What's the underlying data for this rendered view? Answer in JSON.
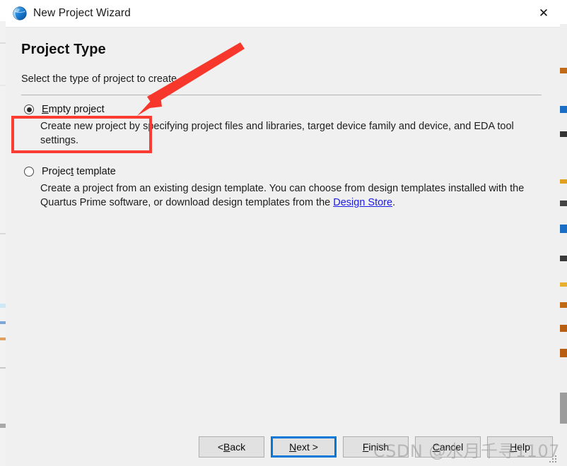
{
  "window": {
    "title": "New Project Wizard",
    "icon": "quartus-globe-icon",
    "close_label": "✕"
  },
  "page": {
    "title": "Project Type",
    "subtitle": "Select the type of project to create."
  },
  "options": [
    {
      "id": "empty-project",
      "label_pre": "",
      "label_mnemonic": "E",
      "label_post": "mpty project",
      "label_full": "Empty project",
      "selected": true,
      "description": "Create new project by specifying project files and libraries, target device family and device, and EDA tool settings."
    },
    {
      "id": "project-template",
      "label_pre": "Projec",
      "label_mnemonic": "t",
      "label_post": " template",
      "label_full": "Project template",
      "selected": false,
      "description_pre": "Create a project from an existing design template. You can choose from design templates installed with the Quartus Prime software, or download design templates from the ",
      "link_text": "Design Store",
      "description_post": "."
    }
  ],
  "footer": {
    "buttons": [
      {
        "id": "back",
        "pre": "< ",
        "mnemonic": "B",
        "post": "ack",
        "full": "< Back",
        "default": false
      },
      {
        "id": "next",
        "pre": "",
        "mnemonic": "N",
        "post": "ext >",
        "full": "Next >",
        "default": true
      },
      {
        "id": "finish",
        "pre": "",
        "mnemonic": "F",
        "post": "inish",
        "full": "Finish",
        "default": false
      },
      {
        "id": "cancel",
        "pre": "",
        "mnemonic": "C",
        "post": "ancel",
        "full": "Cancel",
        "default": false
      },
      {
        "id": "help",
        "pre": "",
        "mnemonic": "H",
        "post": "elp",
        "full": "Help",
        "default": false
      }
    ]
  },
  "watermark": {
    "text": "CSDN @水月千寻1107"
  },
  "annotations": {
    "highlight_target": "empty-project-option",
    "color": "#fa3c32"
  }
}
